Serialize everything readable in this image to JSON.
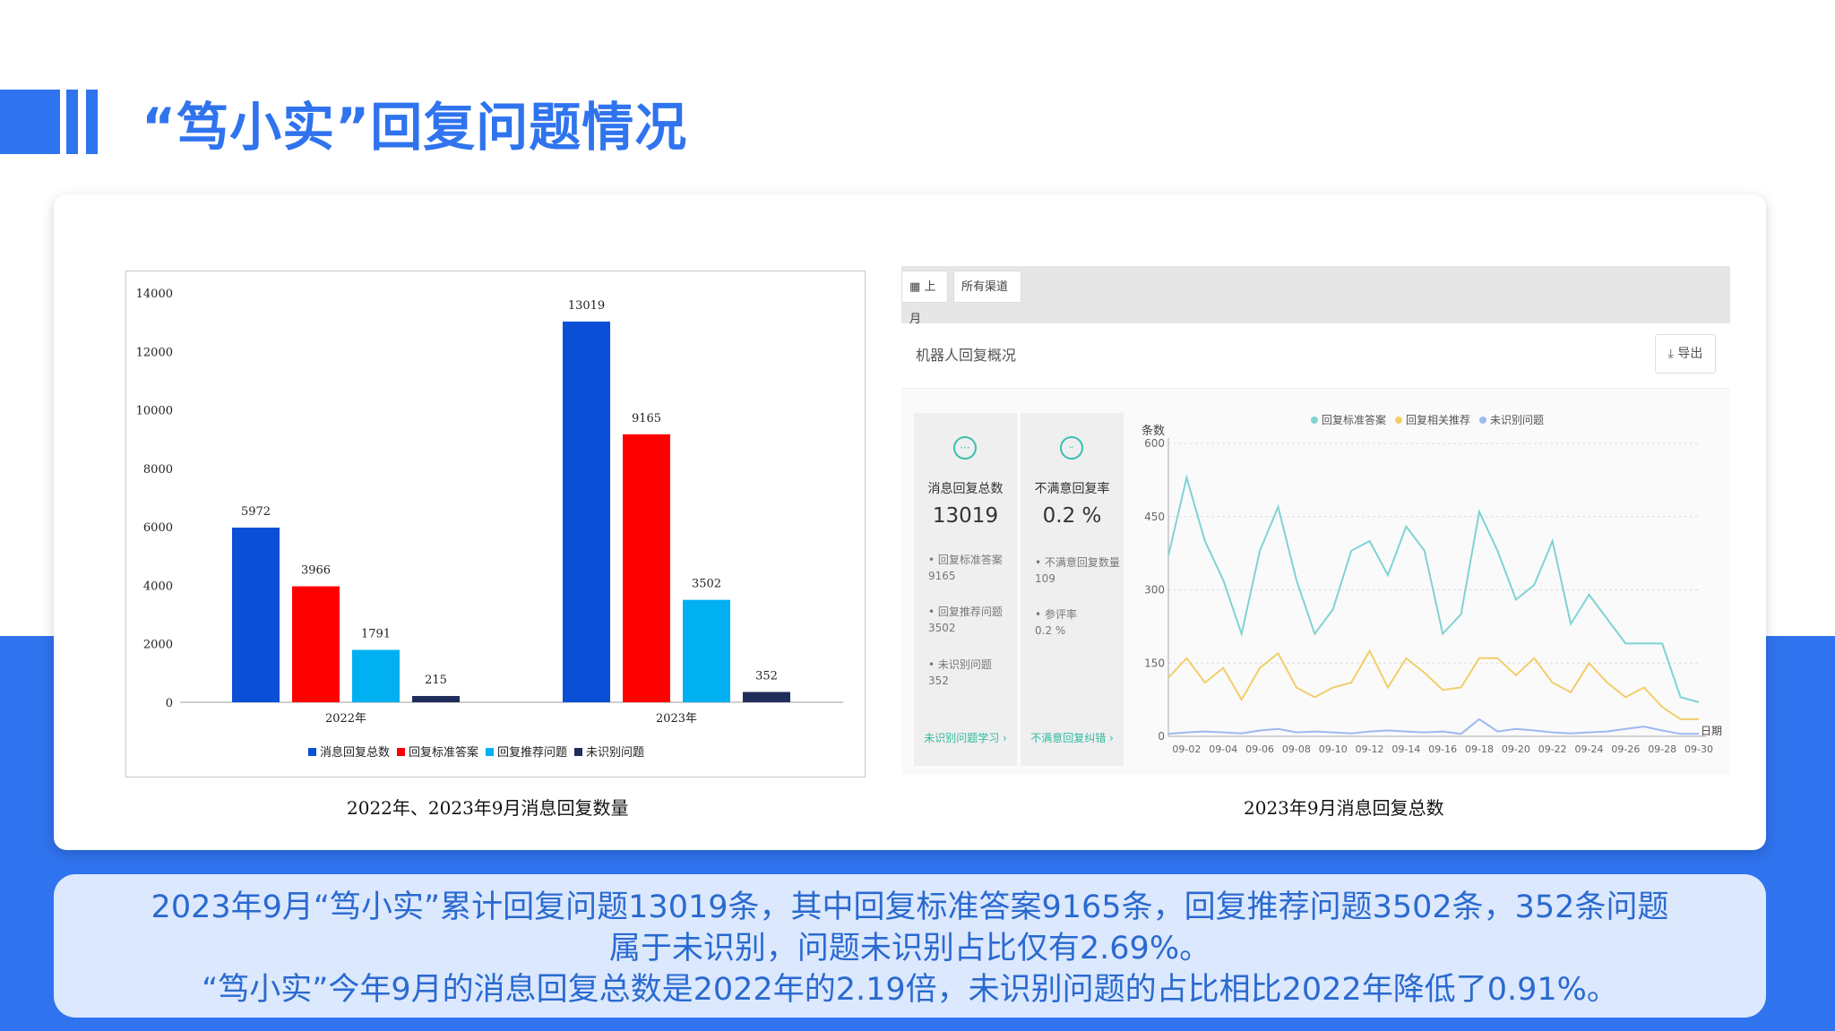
{
  "title": "“笃小实”回复问题情况",
  "left_caption": "2022年、2023年9月消息回复数量",
  "right_caption": "2023年9月消息回复总数",
  "screenshot": {
    "period_chip": "上月",
    "channel_chip": "所有渠道",
    "panel_title": "机器人回复概况",
    "export_label": "导出",
    "stat1": {
      "label": "消息回复总数",
      "value": "13019",
      "items": [
        {
          "label": "回复标准答案",
          "value": "9165"
        },
        {
          "label": "回复推荐问题",
          "value": "3502"
        },
        {
          "label": "未识别问题",
          "value": "352"
        }
      ],
      "link": "未识别问题学习 ›"
    },
    "stat2": {
      "label": "不满意回复率",
      "value": "0.2 %",
      "items": [
        {
          "label": "不满意回复数量",
          "value": "109"
        },
        {
          "label": "参评率",
          "value": "0.2 %"
        }
      ],
      "link": "不满意回复纠错 ›"
    }
  },
  "summary": {
    "line1": "2023年9月“笃小实”累计回复问题13019条，其中回复标准答案9165条，回复推荐问题3502条，352条问题",
    "line2": "属于未识别，问题未识别占比仅有2.69%。",
    "line3": "“笃小实”今年9月的消息回复总数是2022年的2.19倍，未识别问题的占比相比2022年降低了0.91%。"
  },
  "colors": {
    "accent": "#2f73ee",
    "series1": "#0a4fd6",
    "series2": "#ff0000",
    "series3": "#00b0f0",
    "series4": "#1f2d5a",
    "line_teal": "#7fd3d3",
    "line_yellow": "#f2cd6a",
    "line_blue": "#9db9ef"
  },
  "chart_data": [
    {
      "type": "bar",
      "categories": [
        "2022年",
        "2023年"
      ],
      "series": [
        {
          "name": "消息回复总数",
          "values": [
            5972,
            13019
          ]
        },
        {
          "name": "回复标准答案",
          "values": [
            3966,
            9165
          ]
        },
        {
          "name": "回复推荐问题",
          "values": [
            1791,
            3502
          ]
        },
        {
          "name": "未识别问题",
          "values": [
            215,
            352
          ]
        }
      ],
      "ylim": [
        0,
        14000
      ],
      "yticks": [
        0,
        2000,
        4000,
        6000,
        8000,
        10000,
        12000,
        14000
      ],
      "legend": "bottom",
      "grid": false
    },
    {
      "type": "line",
      "ylabel": "条数",
      "xlabel": "日期",
      "ylim": [
        0,
        600
      ],
      "yticks": [
        0,
        150,
        300,
        450,
        600
      ],
      "x": [
        "09-01",
        "09-02",
        "09-03",
        "09-04",
        "09-05",
        "09-06",
        "09-07",
        "09-08",
        "09-09",
        "09-10",
        "09-11",
        "09-12",
        "09-13",
        "09-14",
        "09-15",
        "09-16",
        "09-17",
        "09-18",
        "09-19",
        "09-20",
        "09-21",
        "09-22",
        "09-23",
        "09-24",
        "09-25",
        "09-26",
        "09-27",
        "09-28",
        "09-29",
        "09-30"
      ],
      "xticks": [
        "09-02",
        "09-04",
        "09-06",
        "09-08",
        "09-10",
        "09-12",
        "09-14",
        "09-16",
        "09-18",
        "09-20",
        "09-22",
        "09-24",
        "09-26",
        "09-28",
        "09-30"
      ],
      "series": [
        {
          "name": "回复标准答案",
          "values": [
            370,
            530,
            400,
            320,
            210,
            380,
            470,
            320,
            210,
            260,
            380,
            400,
            330,
            430,
            380,
            210,
            250,
            460,
            380,
            280,
            310,
            400,
            230,
            290,
            240,
            190,
            190,
            190,
            80,
            70
          ]
        },
        {
          "name": "回复相关推荐",
          "values": [
            120,
            160,
            110,
            140,
            75,
            140,
            170,
            100,
            80,
            100,
            110,
            175,
            100,
            160,
            130,
            95,
            100,
            160,
            160,
            125,
            160,
            110,
            90,
            150,
            110,
            80,
            100,
            60,
            35,
            35
          ]
        },
        {
          "name": "未识别问题",
          "values": [
            5,
            8,
            10,
            8,
            6,
            12,
            15,
            8,
            10,
            8,
            6,
            10,
            12,
            10,
            8,
            10,
            5,
            35,
            10,
            15,
            12,
            8,
            6,
            8,
            10,
            15,
            20,
            12,
            5,
            5
          ]
        }
      ],
      "legend": "top",
      "grid": true
    }
  ]
}
